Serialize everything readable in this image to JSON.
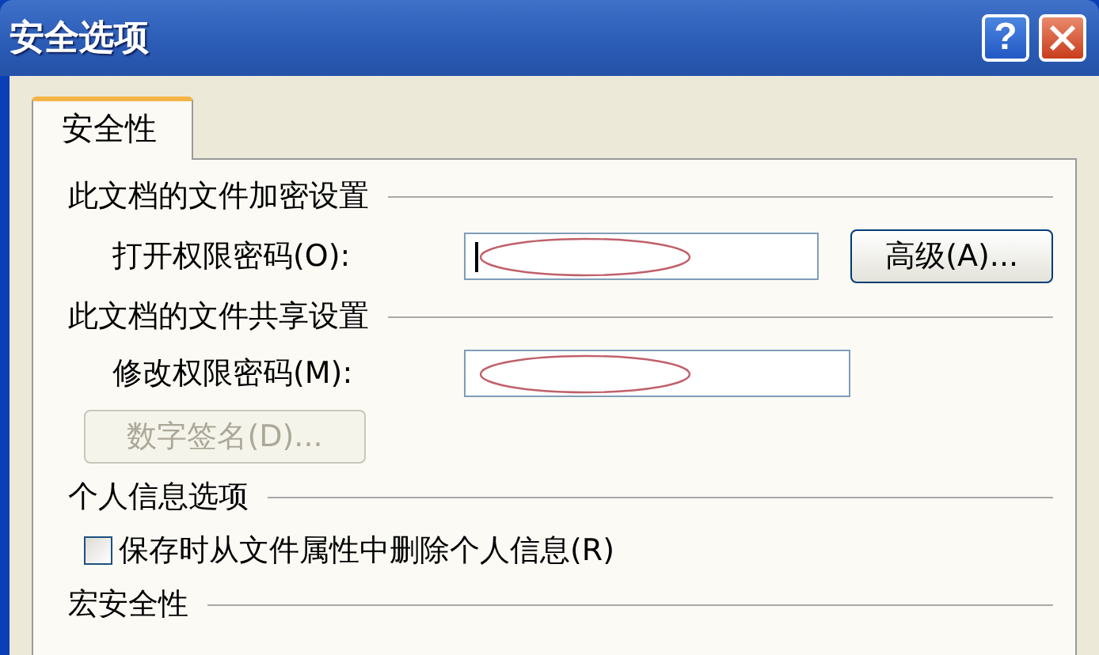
{
  "window": {
    "title": "安全选项",
    "buttons": [
      {
        "kind": "help",
        "label": "?"
      },
      {
        "kind": "close"
      }
    ]
  },
  "tabs": [
    {
      "label": "安全性",
      "selected": true
    }
  ],
  "sections": [
    {
      "title": "此文档的文件加密设置",
      "rows": [
        {
          "kind": "password",
          "label": "打开权限密码(O):",
          "focused": true,
          "button": {
            "label": "高级(A)...",
            "disabled": false
          }
        }
      ]
    },
    {
      "title": "此文档的文件共享设置",
      "rows": [
        {
          "kind": "password",
          "label": "修改权限密码(M):",
          "focused": false
        },
        {
          "kind": "button",
          "label": "数字签名(D)...",
          "disabled": true
        }
      ]
    },
    {
      "title": "个人信息选项",
      "rows": [
        {
          "kind": "checkbox",
          "label": "保存时从文件属性中删除个人信息(R)",
          "checked": false
        }
      ]
    },
    {
      "title": "宏安全性"
    }
  ]
}
